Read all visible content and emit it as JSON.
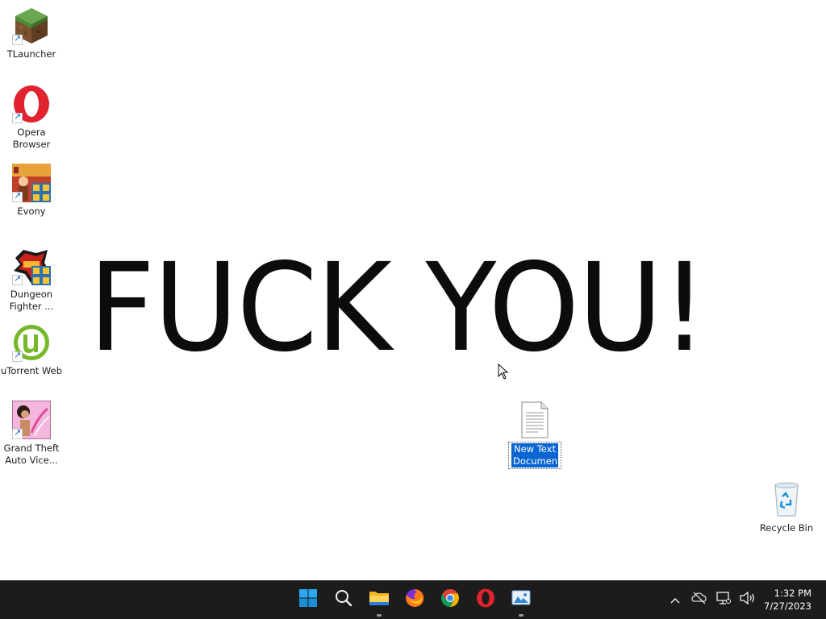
{
  "wallpaper": {
    "text": "FUCK YOU!"
  },
  "desktop": {
    "icons": [
      {
        "label": "TLauncher",
        "icon": "minecraft-grass-block-icon"
      },
      {
        "label": "Opera Browser",
        "icon": "opera-icon"
      },
      {
        "label": "Evony",
        "icon": "evony-icon"
      },
      {
        "label": "Dungeon Fighter ...",
        "icon": "dungeon-fighter-icon"
      },
      {
        "label": "uTorrent Web",
        "icon": "utorrent-icon"
      },
      {
        "label": "Grand Theft Auto Vice...",
        "icon": "gta-vice-city-icon"
      }
    ],
    "selected_file": {
      "label": "New Text Document",
      "icon": "text-document-icon"
    },
    "recycle_bin": {
      "label": "Recycle Bin",
      "icon": "recycle-bin-icon"
    }
  },
  "taskbar": {
    "pinned": [
      {
        "name": "Start",
        "icon": "windows-start-icon"
      },
      {
        "name": "Search",
        "icon": "search-icon"
      },
      {
        "name": "File Explorer",
        "icon": "folder-icon"
      },
      {
        "name": "Firefox",
        "icon": "firefox-icon"
      },
      {
        "name": "Chrome",
        "icon": "chrome-icon"
      },
      {
        "name": "Opera",
        "icon": "opera-icon"
      },
      {
        "name": "Photos",
        "icon": "photos-icon"
      }
    ],
    "tray": {
      "icons": [
        "chevron-up-icon",
        "onedrive-offline-icon",
        "network-icon",
        "volume-icon"
      ]
    },
    "clock": {
      "time": "1:32 PM",
      "date": "7/27/2023"
    }
  },
  "colors": {
    "taskbar_bg": "#1c1c1c",
    "selection_blue": "#0a64d2",
    "wallpaper_bg": "#ffffff"
  }
}
